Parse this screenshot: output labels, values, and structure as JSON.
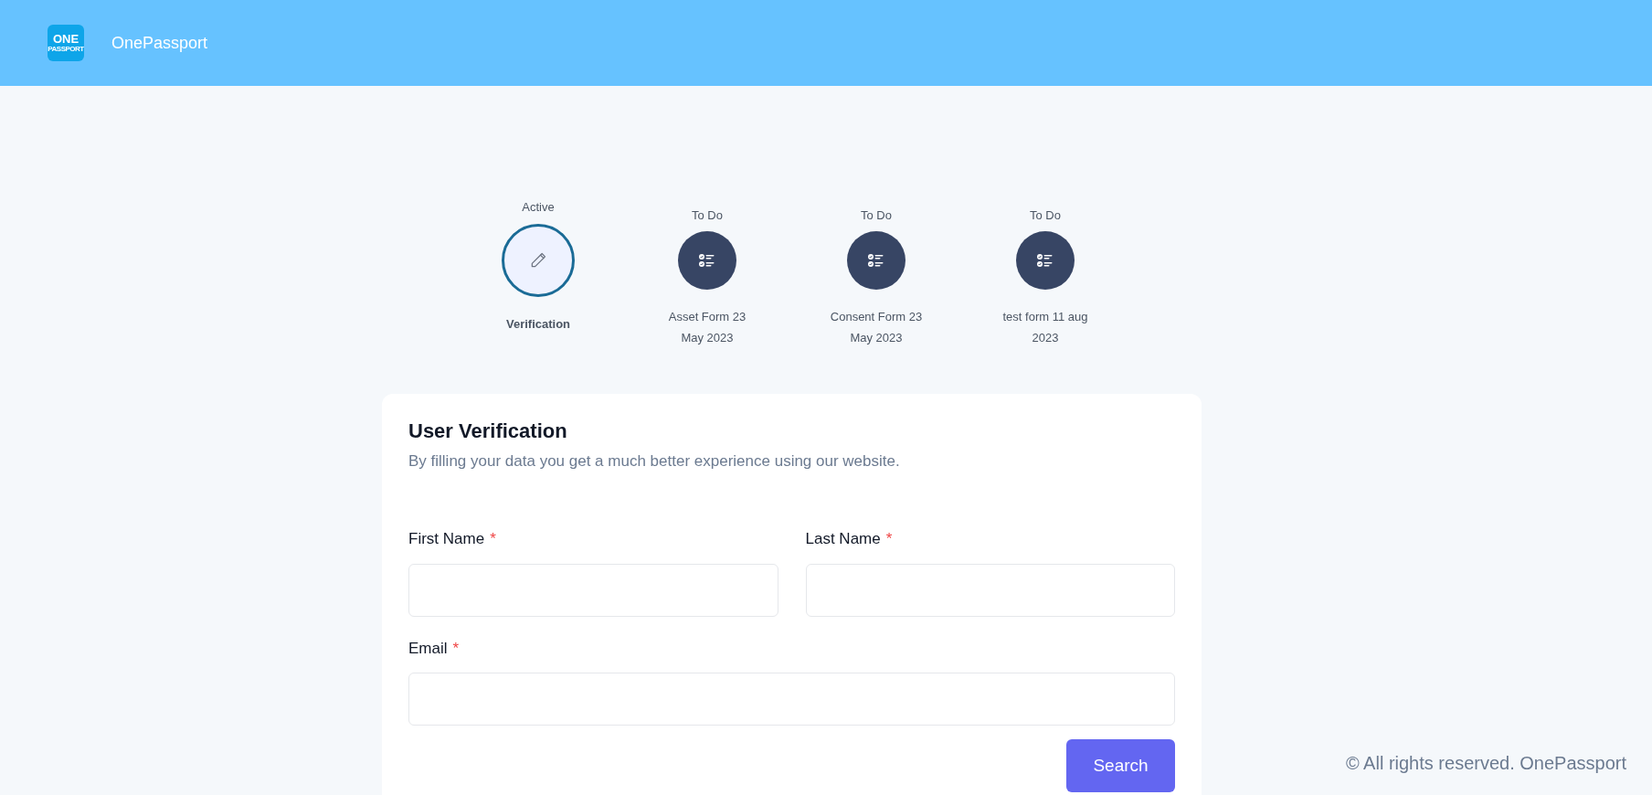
{
  "header": {
    "logo": {
      "line1": "ONE",
      "line2": "PASSPORT"
    },
    "title": "OnePassport"
  },
  "steps": [
    {
      "kind": "active",
      "status": "Active",
      "name": "Verification"
    },
    {
      "kind": "todo",
      "status": "To Do",
      "name": "Asset Form 23 May 2023"
    },
    {
      "kind": "todo",
      "status": "To Do",
      "name": "Consent Form 23 May 2023"
    },
    {
      "kind": "todo",
      "status": "To Do",
      "name": "test form 11 aug 2023"
    }
  ],
  "form": {
    "title": "User Verification",
    "subtitle": "By filling your data you get a much better experience using our website.",
    "fields": [
      {
        "label": "First Name",
        "required_mark": "*",
        "wide": false
      },
      {
        "label": "Last Name",
        "required_mark": "*",
        "wide": false
      },
      {
        "label": "Email",
        "required_mark": "*",
        "wide": true
      }
    ],
    "button": "Search"
  },
  "footer": "© All rights reserved. OnePassport"
}
